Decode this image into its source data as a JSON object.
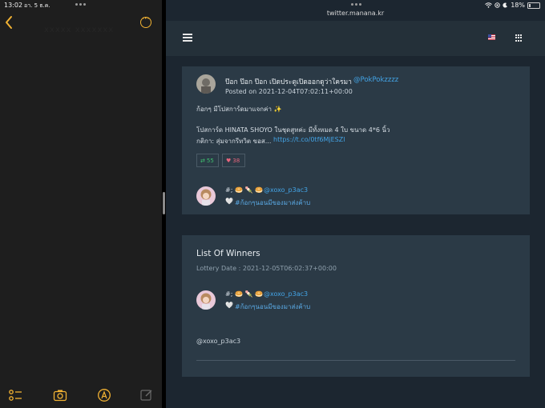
{
  "left_status": {
    "time": "13:02",
    "date": "อา. 5 ธ.ค."
  },
  "notes": {
    "faint_title": "xxxxx xxxxxxx",
    "icons": [
      "chevron-left-icon",
      "more-icon",
      "checklist-icon",
      "camera-icon",
      "markup-icon",
      "compose-icon"
    ],
    "accent_color": "#f2b233"
  },
  "right_status": {
    "battery": "18%"
  },
  "browser": {
    "url": "twitter.manana.kr"
  },
  "nav": {
    "icons": [
      "hamburger-menu-icon",
      "us-flag-icon",
      "grid-apps-icon"
    ]
  },
  "tweet": {
    "display_name": "ป๊อก ป๊อก ป๊อก เปิดประตูเปิดออกดูว่าใครมา",
    "handle": "@PokPokzzzz",
    "posted": "Posted on 2021-12-04T07:02:11+00:00",
    "line1": "ก้อกๆ มีโปสการ์ดมาแจกค่า ✨",
    "line2": "โปสการ์ด HINATA SHOYO ในชุดสูทค่ะ มีทั้งหมด 4 ใบ ขนาด 4*6 นิ้ว",
    "line3_text": "กติกา: สุ่มจากรีทวิต ขอส...",
    "line3_link": "https://t.co/0tf6MjESZl",
    "retweets": "55",
    "likes": "38",
    "reply": {
      "prefix": "#; 🥯 🍡 🥯",
      "handle": "@xoxo_p3ac3",
      "heart": "🤍",
      "hashtag": "#ก้อกๆนอนมีของมาส่งค้าบ"
    }
  },
  "winners": {
    "title": "List Of Winners",
    "lottery_date": "Lottery Date : 2021-12-05T06:02:37+00:00",
    "winner": {
      "prefix": "#; 🥯 🍡 🥯",
      "handle": "@xoxo_p3ac3",
      "heart": "🤍",
      "hashtag": "#ก้อกๆนอนมีของมาส่งค้าบ"
    },
    "plain_handle": "@xoxo_p3ac3"
  },
  "colors": {
    "background": "#1c2630",
    "card": "#2b3a46",
    "link": "#43a4e6",
    "retweet": "#3fbf6f",
    "like": "#e0425e"
  }
}
